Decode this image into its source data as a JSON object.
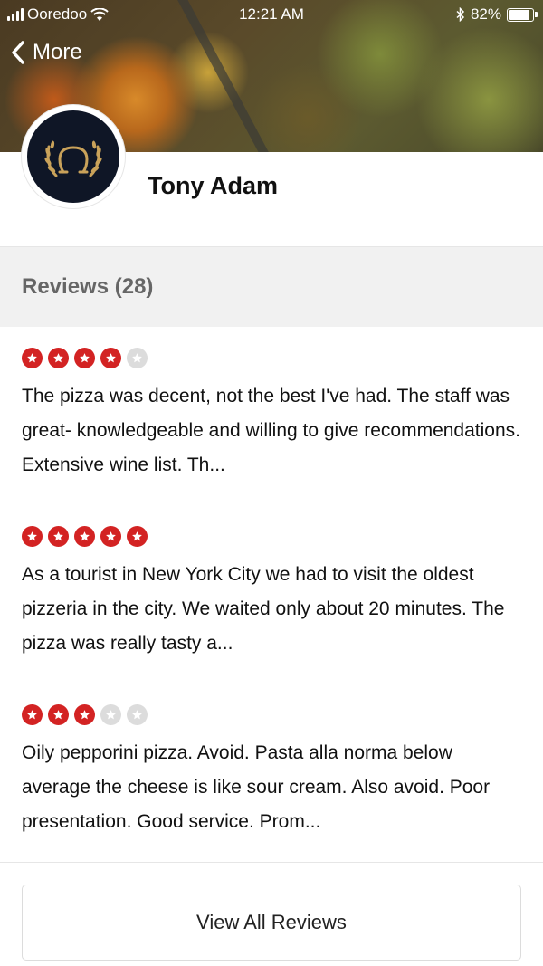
{
  "status_bar": {
    "carrier": "Ooredoo",
    "time": "12:21 AM",
    "battery": "82%"
  },
  "nav": {
    "back_label": "More"
  },
  "profile": {
    "name": "Tony Adam"
  },
  "reviews_section": {
    "title": "Reviews (28)"
  },
  "reviews": [
    {
      "rating": 4,
      "max": 5,
      "text": "The pizza was decent, not the best I've had. The staff was great- knowledgeable and willing to give recommendations. Extensive wine list. Th..."
    },
    {
      "rating": 5,
      "max": 5,
      "text": "As a tourist in New York City we had to visit the oldest pizzeria in the city. We waited only about 20 minutes. The pizza was really tasty a..."
    },
    {
      "rating": 3,
      "max": 5,
      "text": "Oily pepporini pizza. Avoid. Pasta alla norma below average the cheese is like sour cream. Also avoid. Poor presentation. Good service. Prom..."
    }
  ],
  "view_all_label": "View All Reviews",
  "colors": {
    "star_on": "#d32323",
    "star_off": "#dcdcdc",
    "section_bg": "#f1f1f1",
    "avatar_bg": "#0f1626",
    "logo_gold": "#c9a25a"
  }
}
